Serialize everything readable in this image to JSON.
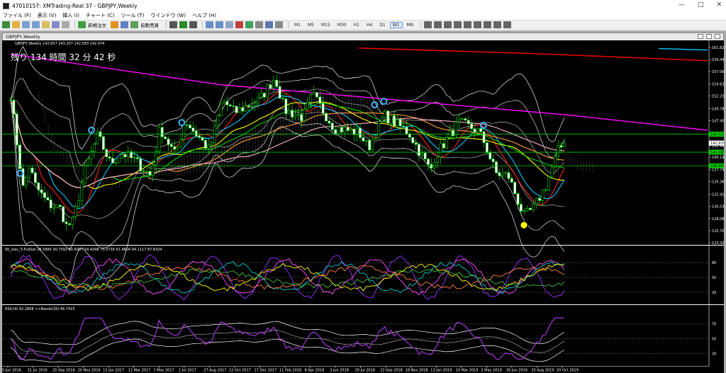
{
  "window": {
    "title": "47010157: XMTrading-Real 37 - GBPJPY,Weekly",
    "buttons": [
      "—",
      "□",
      "✕"
    ]
  },
  "menu": [
    "ファイル (F)",
    "表示 (V)",
    "挿入 (I)",
    "チャート (C)",
    "ツール (T)",
    "ウインドウ (W)",
    "ヘルプ (H)"
  ],
  "toolbar": {
    "new_order": "新規注文",
    "auto_trade": "自動売買",
    "timeframes": [
      "M1",
      "M5",
      "M15",
      "M30",
      "H1",
      "H4",
      "D1",
      "W1",
      "MN"
    ],
    "active_timeframe": "W1"
  },
  "chart_window": {
    "caption": "GBPJPY,Weekly"
  },
  "main_chart": {
    "info": "GBPJPY,Weekly  142.657 143.207 142.583 142.974",
    "countdown": "残り 134 時間 32 分 42 秒",
    "price_scale": [
      "161.820",
      "159.445",
      "157.060",
      "154.630",
      "152.230",
      "149.780",
      "147.400",
      "144.950",
      "142.440",
      "140.190",
      "137.740",
      "135.360",
      "132.910",
      "130.530",
      "128.080",
      "125.700",
      "123.320"
    ],
    "current_price": "142.974",
    "price_tags": [
      {
        "label": "144.720",
        "price": 144.72,
        "color": "#00c800"
      },
      {
        "label": "142.974",
        "price": 142.974,
        "color": "#ffffff"
      },
      {
        "label": "141.165",
        "price": 141.165,
        "color": "#00c800"
      },
      {
        "label": "138.493",
        "price": 138.493,
        "color": "#00c800"
      }
    ]
  },
  "stoch_panel": {
    "label": "00_stoc_5-FullSet 28.5884 30.7592 50.6087 54.4298 70.0739 91.4804 94.1117 87.8324",
    "scale": [
      "80",
      "50",
      "20"
    ]
  },
  "rsi_panel": {
    "label": "RSI(14) 62.2808  <<Bands(20) 46.7415",
    "scale": [
      "70",
      "50",
      "30"
    ]
  },
  "x_axis": [
    "5 Jun 2016",
    "31 Jul 2016",
    "25 Sep 2016",
    "20 Nov 2016",
    "15 Jan 2017",
    "12 Mar 2017",
    "7 May 2017",
    "2 Jul 2017",
    "27 Aug 2017",
    "22 Oct 2017",
    "17 Dec 2017",
    "11 Feb 2018",
    "8 Apr 2018",
    "3 Jun 2018",
    "29 Jul 2018",
    "23 Sep 2018",
    "18 Nov 2018",
    "13 Jan 2019",
    "10 Mar 2019",
    "5 May 2019",
    "30 Jun 2019",
    "25 Aug 2019",
    "20 Oct 2019"
  ],
  "chart_data": {
    "type": "candlestick",
    "symbol": "GBPJPY",
    "timeframe": "Weekly",
    "ylim": [
      123.32,
      161.82
    ],
    "close_path": [
      {
        "date": "2016-06-05",
        "close": 152.5
      },
      {
        "date": "2016-06-19",
        "close": 143.0
      },
      {
        "date": "2016-07-03",
        "close": 134.0
      },
      {
        "date": "2016-07-17",
        "close": 138.5
      },
      {
        "date": "2016-07-31",
        "close": 134.5
      },
      {
        "date": "2016-08-28",
        "close": 131.0
      },
      {
        "date": "2016-09-25",
        "close": 130.0
      },
      {
        "date": "2016-10-09",
        "close": 126.5
      },
      {
        "date": "2016-10-23",
        "close": 127.5
      },
      {
        "date": "2016-11-20",
        "close": 138.0
      },
      {
        "date": "2016-12-18",
        "close": 144.5
      },
      {
        "date": "2017-01-15",
        "close": 139.0
      },
      {
        "date": "2017-02-12",
        "close": 141.0
      },
      {
        "date": "2017-03-12",
        "close": 139.5
      },
      {
        "date": "2017-04-16",
        "close": 136.5
      },
      {
        "date": "2017-05-07",
        "close": 146.0
      },
      {
        "date": "2017-06-11",
        "close": 140.5
      },
      {
        "date": "2017-07-02",
        "close": 147.5
      },
      {
        "date": "2017-08-27",
        "close": 141.5
      },
      {
        "date": "2017-09-24",
        "close": 151.5
      },
      {
        "date": "2017-10-22",
        "close": 149.0
      },
      {
        "date": "2017-12-17",
        "close": 151.5
      },
      {
        "date": "2018-01-21",
        "close": 156.0
      },
      {
        "date": "2018-02-11",
        "close": 149.5
      },
      {
        "date": "2018-03-25",
        "close": 148.0
      },
      {
        "date": "2018-04-15",
        "close": 152.5
      },
      {
        "date": "2018-06-03",
        "close": 146.0
      },
      {
        "date": "2018-07-29",
        "close": 145.0
      },
      {
        "date": "2018-08-19",
        "close": 142.0
      },
      {
        "date": "2018-09-23",
        "close": 148.5
      },
      {
        "date": "2018-11-18",
        "close": 145.0
      },
      {
        "date": "2019-01-06",
        "close": 137.5
      },
      {
        "date": "2019-01-13",
        "close": 140.0
      },
      {
        "date": "2019-03-10",
        "close": 147.0
      },
      {
        "date": "2019-04-21",
        "close": 145.5
      },
      {
        "date": "2019-05-05",
        "close": 143.5
      },
      {
        "date": "2019-06-02",
        "close": 137.0
      },
      {
        "date": "2019-06-30",
        "close": 136.5
      },
      {
        "date": "2019-08-04",
        "close": 128.5
      },
      {
        "date": "2019-08-25",
        "close": 130.0
      },
      {
        "date": "2019-09-22",
        "close": 134.5
      },
      {
        "date": "2019-10-20",
        "close": 141.5
      },
      {
        "date": "2019-11-03",
        "close": 142.97
      }
    ],
    "moving_averages": [
      {
        "color": "#ff00ff",
        "path": [
          [
            0,
            160.5
          ],
          [
            0.3,
            154.5
          ],
          [
            0.55,
            151.5
          ],
          [
            0.8,
            148.5
          ],
          [
            1.0,
            145.5
          ]
        ]
      },
      {
        "color": "#ff0000",
        "path": [
          [
            0.5,
            161.7
          ],
          [
            0.75,
            160.6
          ],
          [
            1.0,
            159.2
          ]
        ]
      },
      {
        "color": "#00c8ff",
        "path": [
          [
            0.93,
            161.6
          ],
          [
            1.0,
            161.3
          ]
        ]
      }
    ]
  }
}
